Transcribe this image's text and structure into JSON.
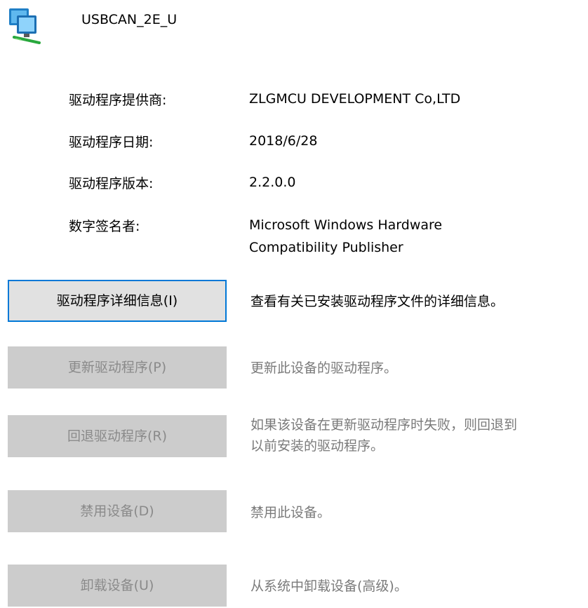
{
  "device": {
    "icon": "network-adapter-icon",
    "name": "USBCAN_2E_U"
  },
  "properties": {
    "provider": {
      "label": "驱动程序提供商:",
      "value": "ZLGMCU DEVELOPMENT Co,LTD"
    },
    "date": {
      "label": "驱动程序日期:",
      "value": "2018/6/28"
    },
    "version": {
      "label": "驱动程序版本:",
      "value": "2.2.0.0"
    },
    "signer": {
      "label": "数字签名者:",
      "value_lines": [
        "Microsoft Windows Hardware",
        "Compatibility Publisher"
      ]
    }
  },
  "actions": {
    "driver_details": {
      "label": "驱动程序详细信息(I)",
      "desc": "查看有关已安装驱动程序文件的详细信息。",
      "enabled": true
    },
    "update_driver": {
      "label": "更新驱动程序(P)",
      "desc": "更新此设备的驱动程序。",
      "enabled": false
    },
    "roll_back": {
      "label": "回退驱动程序(R)",
      "desc_lines": [
        "如果该设备在更新驱动程序时失败，则回退到",
        "以前安装的驱动程序。"
      ],
      "enabled": false
    },
    "disable_device": {
      "label": "禁用设备(D)",
      "desc": "禁用此设备。",
      "enabled": false
    },
    "uninstall_device": {
      "label": "卸载设备(U)",
      "desc": "从系统中卸载设备(高级)。",
      "enabled": false
    }
  },
  "colors": {
    "accent_border": "#0078d7",
    "disabled_button_bg": "#cccccc",
    "disabled_text": "#8a8a8a"
  }
}
